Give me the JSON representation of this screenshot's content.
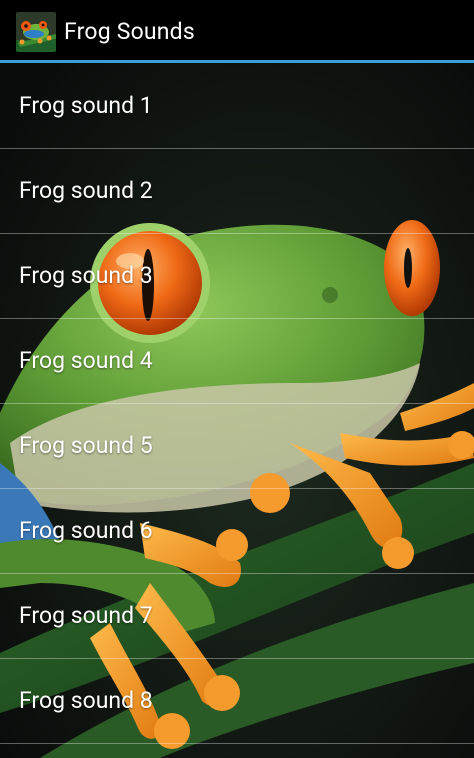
{
  "app": {
    "title": "Frog Sounds",
    "icon": "tree-frog-app-icon"
  },
  "colors": {
    "actionbar_bg": "#000000",
    "divider": "#3aa0d6",
    "frog_green": "#6aa43a",
    "eye_orange": "#f06a13",
    "toe_orange": "#f59a2c",
    "text": "#ffffff"
  },
  "list": {
    "items": [
      {
        "label": "Frog sound 1"
      },
      {
        "label": "Frog sound 2"
      },
      {
        "label": "Frog sound 3"
      },
      {
        "label": "Frog sound 4"
      },
      {
        "label": "Frog sound 5"
      },
      {
        "label": "Frog sound 6"
      },
      {
        "label": "Frog sound 7"
      },
      {
        "label": "Frog sound 8"
      }
    ]
  }
}
